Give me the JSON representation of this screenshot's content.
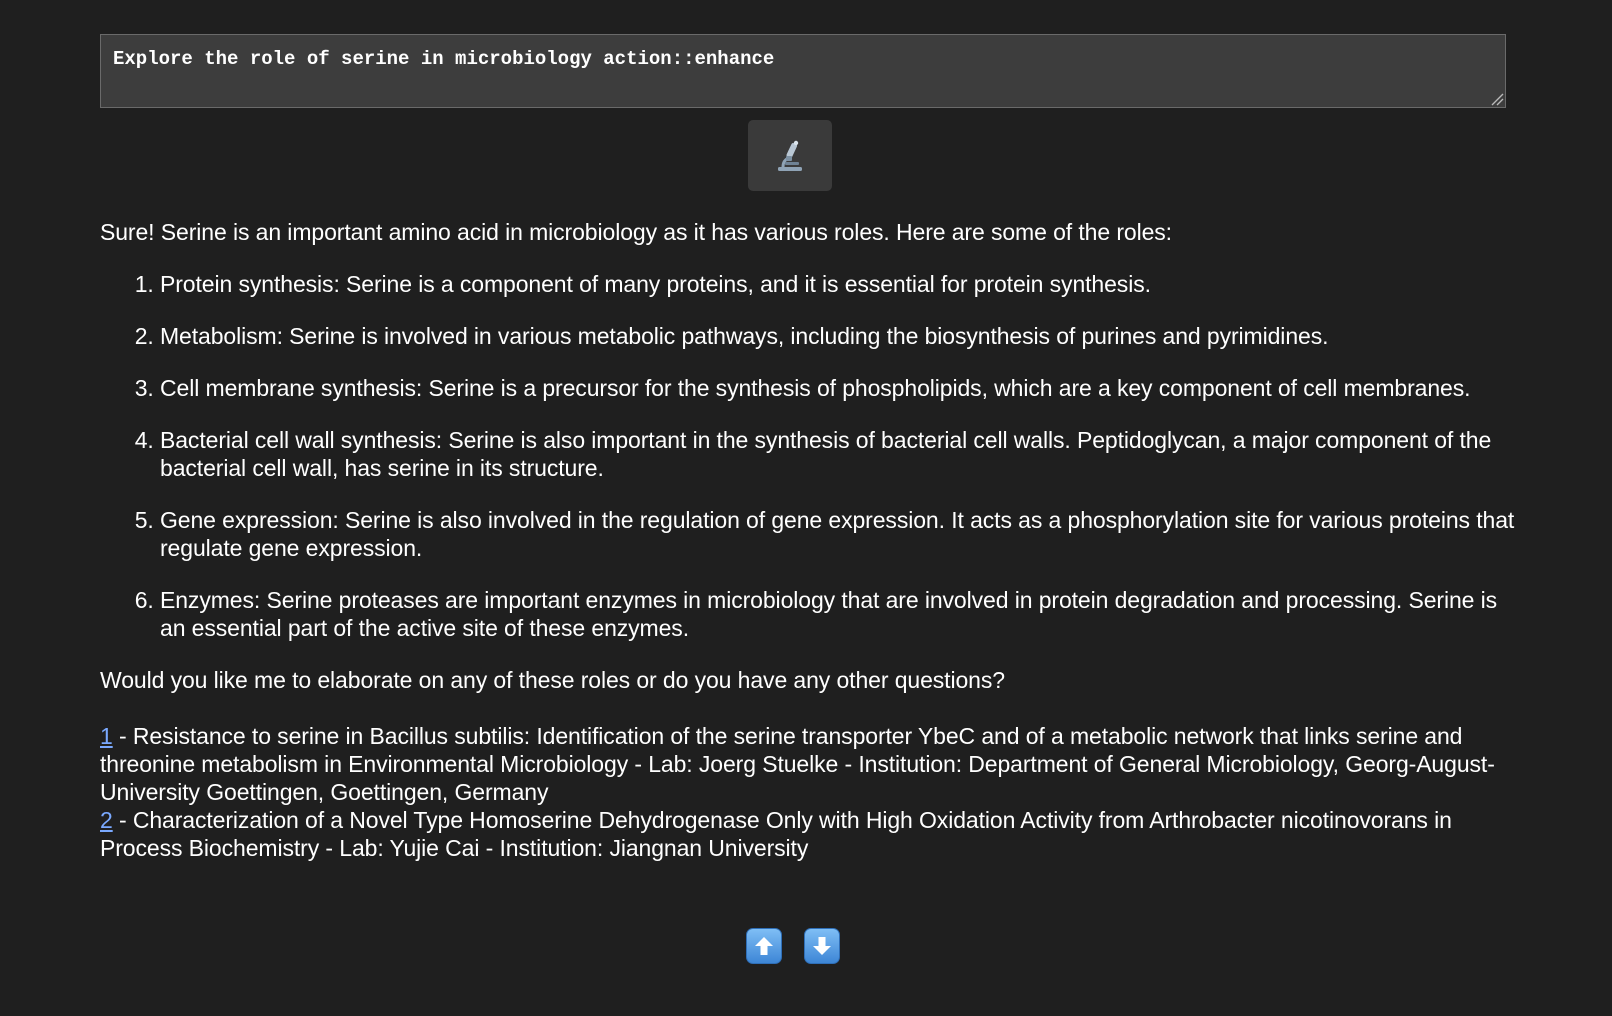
{
  "prompt": {
    "value": "Explore the role of serine in microbiology action::enhance"
  },
  "submit_button": {
    "icon": "microscope-icon"
  },
  "response": {
    "intro": "Sure! Serine is an important amino acid in microbiology as it has various roles. Here are some of the roles:",
    "roles": [
      "Protein synthesis: Serine is a component of many proteins, and it is essential for protein synthesis.",
      "Metabolism: Serine is involved in various metabolic pathways, including the biosynthesis of purines and pyrimidines.",
      "Cell membrane synthesis: Serine is a precursor for the synthesis of phospholipids, which are a key component of cell membranes.",
      "Bacterial cell wall synthesis: Serine is also important in the synthesis of bacterial cell walls. Peptidoglycan, a major component of the bacterial cell wall, has serine in its structure.",
      "Gene expression: Serine is also involved in the regulation of gene expression. It acts as a phosphorylation site for various proteins that regulate gene expression.",
      "Enzymes: Serine proteases are important enzymes in microbiology that are involved in protein degradation and processing. Serine is an essential part of the active site of these enzymes."
    ],
    "outro": "Would you like me to elaborate on any of these roles or do you have any other questions?"
  },
  "references": [
    {
      "number": "1",
      "text": " - Resistance to serine in Bacillus subtilis: Identification of the serine transporter YbeC and of a metabolic network that links serine and threonine metabolism in Environmental Microbiology - Lab: Joerg Stuelke - Institution: Department of General Microbiology, Georg-August-University Goettingen, Goettingen, Germany"
    },
    {
      "number": "2",
      "text": " - Characterization of a Novel Type Homoserine Dehydrogenase Only with High Oxidation Activity from Arthrobacter nicotinovorans in Process Biochemistry - Lab: Yujie Cai - Institution: Jiangnan University"
    }
  ],
  "nav": {
    "up_icon": "up-arrow-icon",
    "down_icon": "down-arrow-icon",
    "color": "#5a9ee8"
  }
}
